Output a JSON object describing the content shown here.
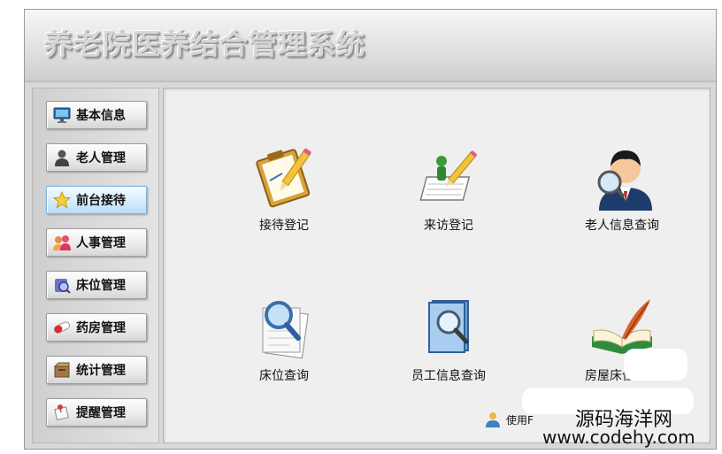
{
  "app": {
    "title": "养老院医养结合管理系统"
  },
  "sidebar": {
    "items": [
      {
        "label": "基本信息",
        "icon": "monitor-icon"
      },
      {
        "label": "老人管理",
        "icon": "person-icon"
      },
      {
        "label": "前台接待",
        "icon": "star-icon",
        "active": true
      },
      {
        "label": "人事管理",
        "icon": "people-icon"
      },
      {
        "label": "床位管理",
        "icon": "bed-icon"
      },
      {
        "label": "药房管理",
        "icon": "pill-icon"
      },
      {
        "label": "统计管理",
        "icon": "box-icon"
      },
      {
        "label": "提醒管理",
        "icon": "pin-icon"
      }
    ]
  },
  "tiles": [
    {
      "label": "接待登记",
      "icon": "clipboard-pencil-icon"
    },
    {
      "label": "来访登记",
      "icon": "notebook-pencil-icon"
    },
    {
      "label": "老人信息查询",
      "icon": "user-magnifier-icon"
    },
    {
      "label": "床位查询",
      "icon": "document-magnifier-icon"
    },
    {
      "label": "员工信息查询",
      "icon": "book-magnifier-icon"
    },
    {
      "label": "房屋床位一览",
      "icon": "open-book-quill-icon"
    }
  ],
  "footer": {
    "text": "使用F",
    "icon": "user-icon"
  },
  "watermark": {
    "line1": "源码海洋网",
    "line2": "www.codehy.com"
  },
  "colors": {
    "active_nav": "#c6e4f8",
    "background": "#efefef"
  }
}
